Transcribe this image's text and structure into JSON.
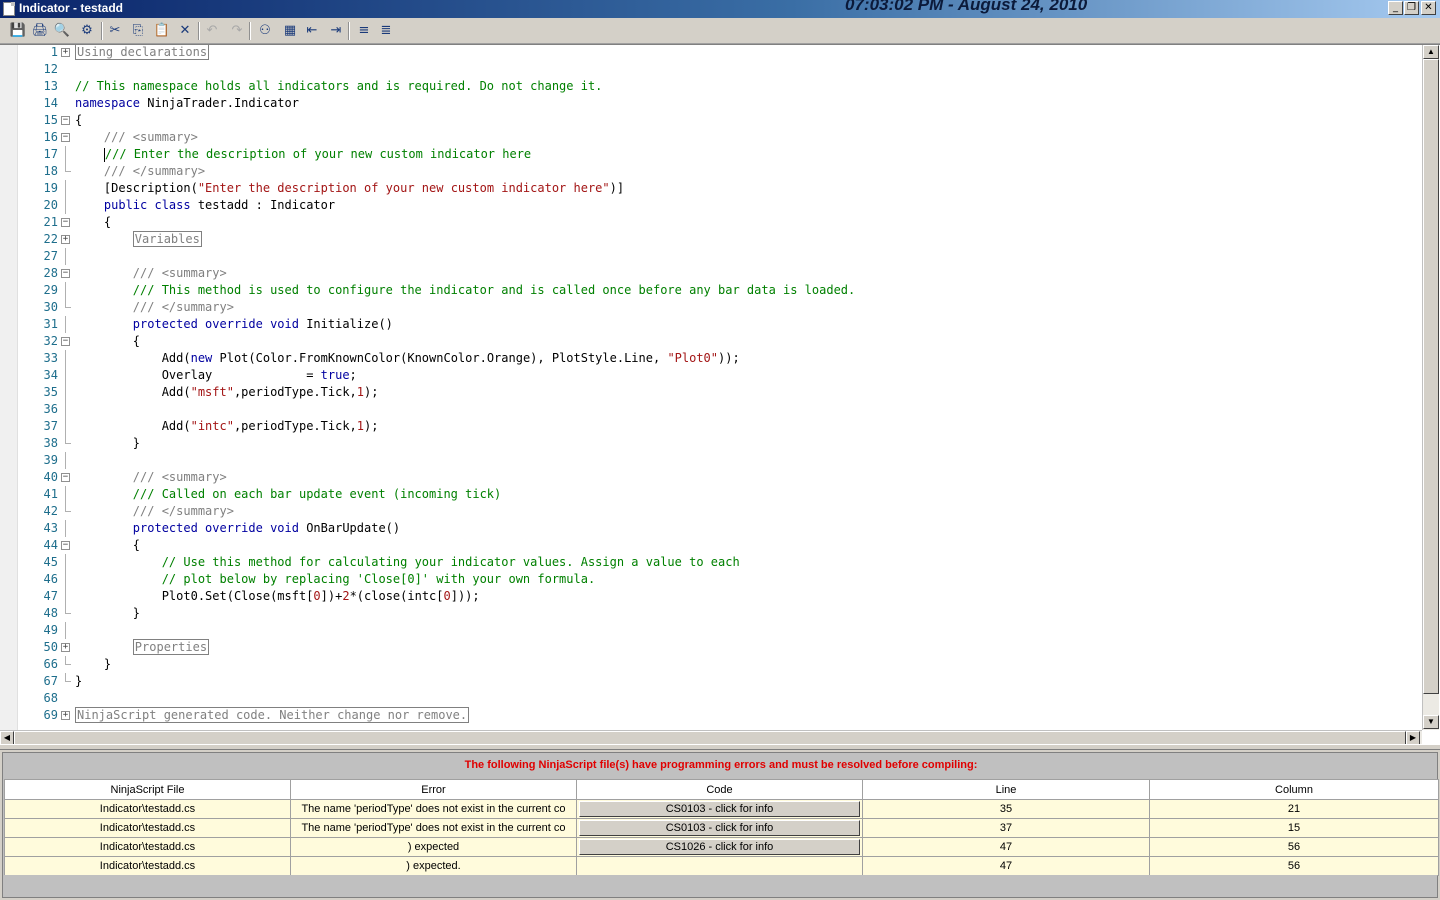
{
  "window": {
    "title": "Indicator - testadd",
    "clock": "07:03:02 PM - August 24, 2010",
    "controls": [
      "minimize",
      "restore",
      "close"
    ]
  },
  "toolbar": {
    "buttons": [
      {
        "name": "save",
        "icon": "save-icon",
        "glyph": "💾",
        "enabled": true
      },
      {
        "name": "print",
        "icon": "print-icon",
        "glyph": "🖨",
        "enabled": true
      },
      {
        "name": "print-preview",
        "icon": "print-preview-icon",
        "glyph": "🔍",
        "enabled": true
      },
      {
        "name": "compile",
        "icon": "compile-icon",
        "glyph": "⚙",
        "enabled": true
      },
      {
        "name": "cut",
        "icon": "cut-icon",
        "glyph": "✂",
        "enabled": true
      },
      {
        "name": "copy",
        "icon": "copy-icon",
        "glyph": "⎘",
        "enabled": true
      },
      {
        "name": "paste",
        "icon": "paste-icon",
        "glyph": "📋",
        "enabled": true
      },
      {
        "name": "delete",
        "icon": "delete-icon",
        "glyph": "✕",
        "enabled": true
      },
      {
        "name": "undo",
        "icon": "undo-icon",
        "glyph": "↶",
        "enabled": false
      },
      {
        "name": "redo",
        "icon": "redo-icon",
        "glyph": "↷",
        "enabled": false
      },
      {
        "name": "find",
        "icon": "find-icon",
        "glyph": "⚇",
        "enabled": true
      },
      {
        "name": "replace",
        "icon": "replace-icon",
        "glyph": "▦",
        "enabled": true
      },
      {
        "name": "outdent",
        "icon": "outdent-icon",
        "glyph": "⇤",
        "enabled": true
      },
      {
        "name": "indent",
        "icon": "indent-icon",
        "glyph": "⇥",
        "enabled": true
      },
      {
        "name": "comment",
        "icon": "comment-icon",
        "glyph": "≡",
        "enabled": true
      },
      {
        "name": "uncomment",
        "icon": "uncomment-icon",
        "glyph": "≣",
        "enabled": true
      }
    ]
  },
  "editor": {
    "lines": [
      {
        "num": "1",
        "fold": "plus",
        "html": "<span class=\"region\">Using declarations</span>"
      },
      {
        "num": "12",
        "fold": "",
        "html": ""
      },
      {
        "num": "13",
        "fold": "",
        "html": "<span class=\"cm\">// This namespace holds all indicators and is required. Do not change it.</span>"
      },
      {
        "num": "14",
        "fold": "",
        "html": "<span class=\"kw\">namespace</span> NinjaTrader.Indicator"
      },
      {
        "num": "15",
        "fold": "minus",
        "html": "{"
      },
      {
        "num": "16",
        "fold": "minus",
        "html": "    <span class=\"dc\">/// &lt;summary&gt;</span>"
      },
      {
        "num": "17",
        "fold": "line",
        "html": "    <span class=\"caret\"></span><span class=\"cm\">/// Enter the description of your new custom indicator here</span>"
      },
      {
        "num": "18",
        "fold": "end",
        "html": "    <span class=\"dc\">/// &lt;/summary&gt;</span>"
      },
      {
        "num": "19",
        "fold": "line",
        "html": "    [Description(<span class=\"st\">\"Enter the description of your new custom indicator here\"</span>)]"
      },
      {
        "num": "20",
        "fold": "line",
        "html": "    <span class=\"kw\">public class</span> testadd : Indicator"
      },
      {
        "num": "21",
        "fold": "minus",
        "html": "    {"
      },
      {
        "num": "22",
        "fold": "plus",
        "html": "        <span class=\"region\">Variables</span>"
      },
      {
        "num": "27",
        "fold": "line",
        "html": ""
      },
      {
        "num": "28",
        "fold": "minus",
        "html": "        <span class=\"dc\">/// &lt;summary&gt;</span>"
      },
      {
        "num": "29",
        "fold": "line",
        "html": "        <span class=\"cm\">/// This method is used to configure the indicator and is called once before any bar data is loaded.</span>"
      },
      {
        "num": "30",
        "fold": "end",
        "html": "        <span class=\"dc\">/// &lt;/summary&gt;</span>"
      },
      {
        "num": "31",
        "fold": "line",
        "html": "        <span class=\"kw\">protected override void</span> Initialize()"
      },
      {
        "num": "32",
        "fold": "minus",
        "html": "        {"
      },
      {
        "num": "33",
        "fold": "line",
        "html": "            Add(<span class=\"kw\">new</span> Plot(Color.FromKnownColor(KnownColor.Orange), PlotStyle.Line, <span class=\"st\">\"Plot0\"</span>));"
      },
      {
        "num": "34",
        "fold": "line",
        "html": "            Overlay             = <span class=\"kw\">true</span>;"
      },
      {
        "num": "35",
        "fold": "line",
        "html": "            Add(<span class=\"st\">\"msft\"</span>,periodType.Tick,<span class=\"nm\">1</span>);"
      },
      {
        "num": "36",
        "fold": "line",
        "html": ""
      },
      {
        "num": "37",
        "fold": "line",
        "html": "            Add(<span class=\"st\">\"intc\"</span>,periodType.Tick,<span class=\"nm\">1</span>);"
      },
      {
        "num": "38",
        "fold": "end",
        "html": "        }"
      },
      {
        "num": "39",
        "fold": "line",
        "html": ""
      },
      {
        "num": "40",
        "fold": "minus",
        "html": "        <span class=\"dc\">/// &lt;summary&gt;</span>"
      },
      {
        "num": "41",
        "fold": "line",
        "html": "        <span class=\"cm\">/// Called on each bar update event (incoming tick)</span>"
      },
      {
        "num": "42",
        "fold": "end",
        "html": "        <span class=\"dc\">/// &lt;/summary&gt;</span>"
      },
      {
        "num": "43",
        "fold": "line",
        "html": "        <span class=\"kw\">protected override void</span> OnBarUpdate()"
      },
      {
        "num": "44",
        "fold": "minus",
        "html": "        {"
      },
      {
        "num": "45",
        "fold": "line",
        "html": "            <span class=\"cm\">// Use this method for calculating your indicator values. Assign a value to each</span>"
      },
      {
        "num": "46",
        "fold": "line",
        "html": "            <span class=\"cm\">// plot below by replacing 'Close[0]' with your own formula.</span>"
      },
      {
        "num": "47",
        "fold": "line",
        "html": "            Plot0.Set(Close(msft[<span class=\"nm\">0</span>])+<span class=\"nm\">2</span>*(close(intc[<span class=\"nm\">0</span>]));"
      },
      {
        "num": "48",
        "fold": "end",
        "html": "        }"
      },
      {
        "num": "49",
        "fold": "line",
        "html": ""
      },
      {
        "num": "50",
        "fold": "plus",
        "html": "        <span class=\"region\">Properties</span>"
      },
      {
        "num": "66",
        "fold": "end",
        "html": "    }"
      },
      {
        "num": "67",
        "fold": "end",
        "html": "}"
      },
      {
        "num": "68",
        "fold": "",
        "html": ""
      },
      {
        "num": "69",
        "fold": "plus",
        "html": "<span class=\"region\">NinjaScript generated code. Neither change nor remove.</span>"
      }
    ]
  },
  "errors": {
    "heading": "The following NinjaScript file(s) have programming errors and must be resolved before compiling:",
    "columns": [
      "NinjaScript File",
      "Error",
      "Code",
      "Line",
      "Column"
    ],
    "rows": [
      {
        "file": "Indicator\\testadd.cs",
        "error": "The name 'periodType' does not exist in the current co",
        "code": "CS0103 - click for info",
        "line": "35",
        "column": "21"
      },
      {
        "file": "Indicator\\testadd.cs",
        "error": "The name 'periodType' does not exist in the current co",
        "code": "CS0103 - click for info",
        "line": "37",
        "column": "15"
      },
      {
        "file": "Indicator\\testadd.cs",
        "error": ") expected",
        "code": "CS1026 - click for info",
        "line": "47",
        "column": "56"
      },
      {
        "file": "Indicator\\testadd.cs",
        "error": ") expected.",
        "code": "",
        "line": "47",
        "column": "56"
      }
    ]
  }
}
